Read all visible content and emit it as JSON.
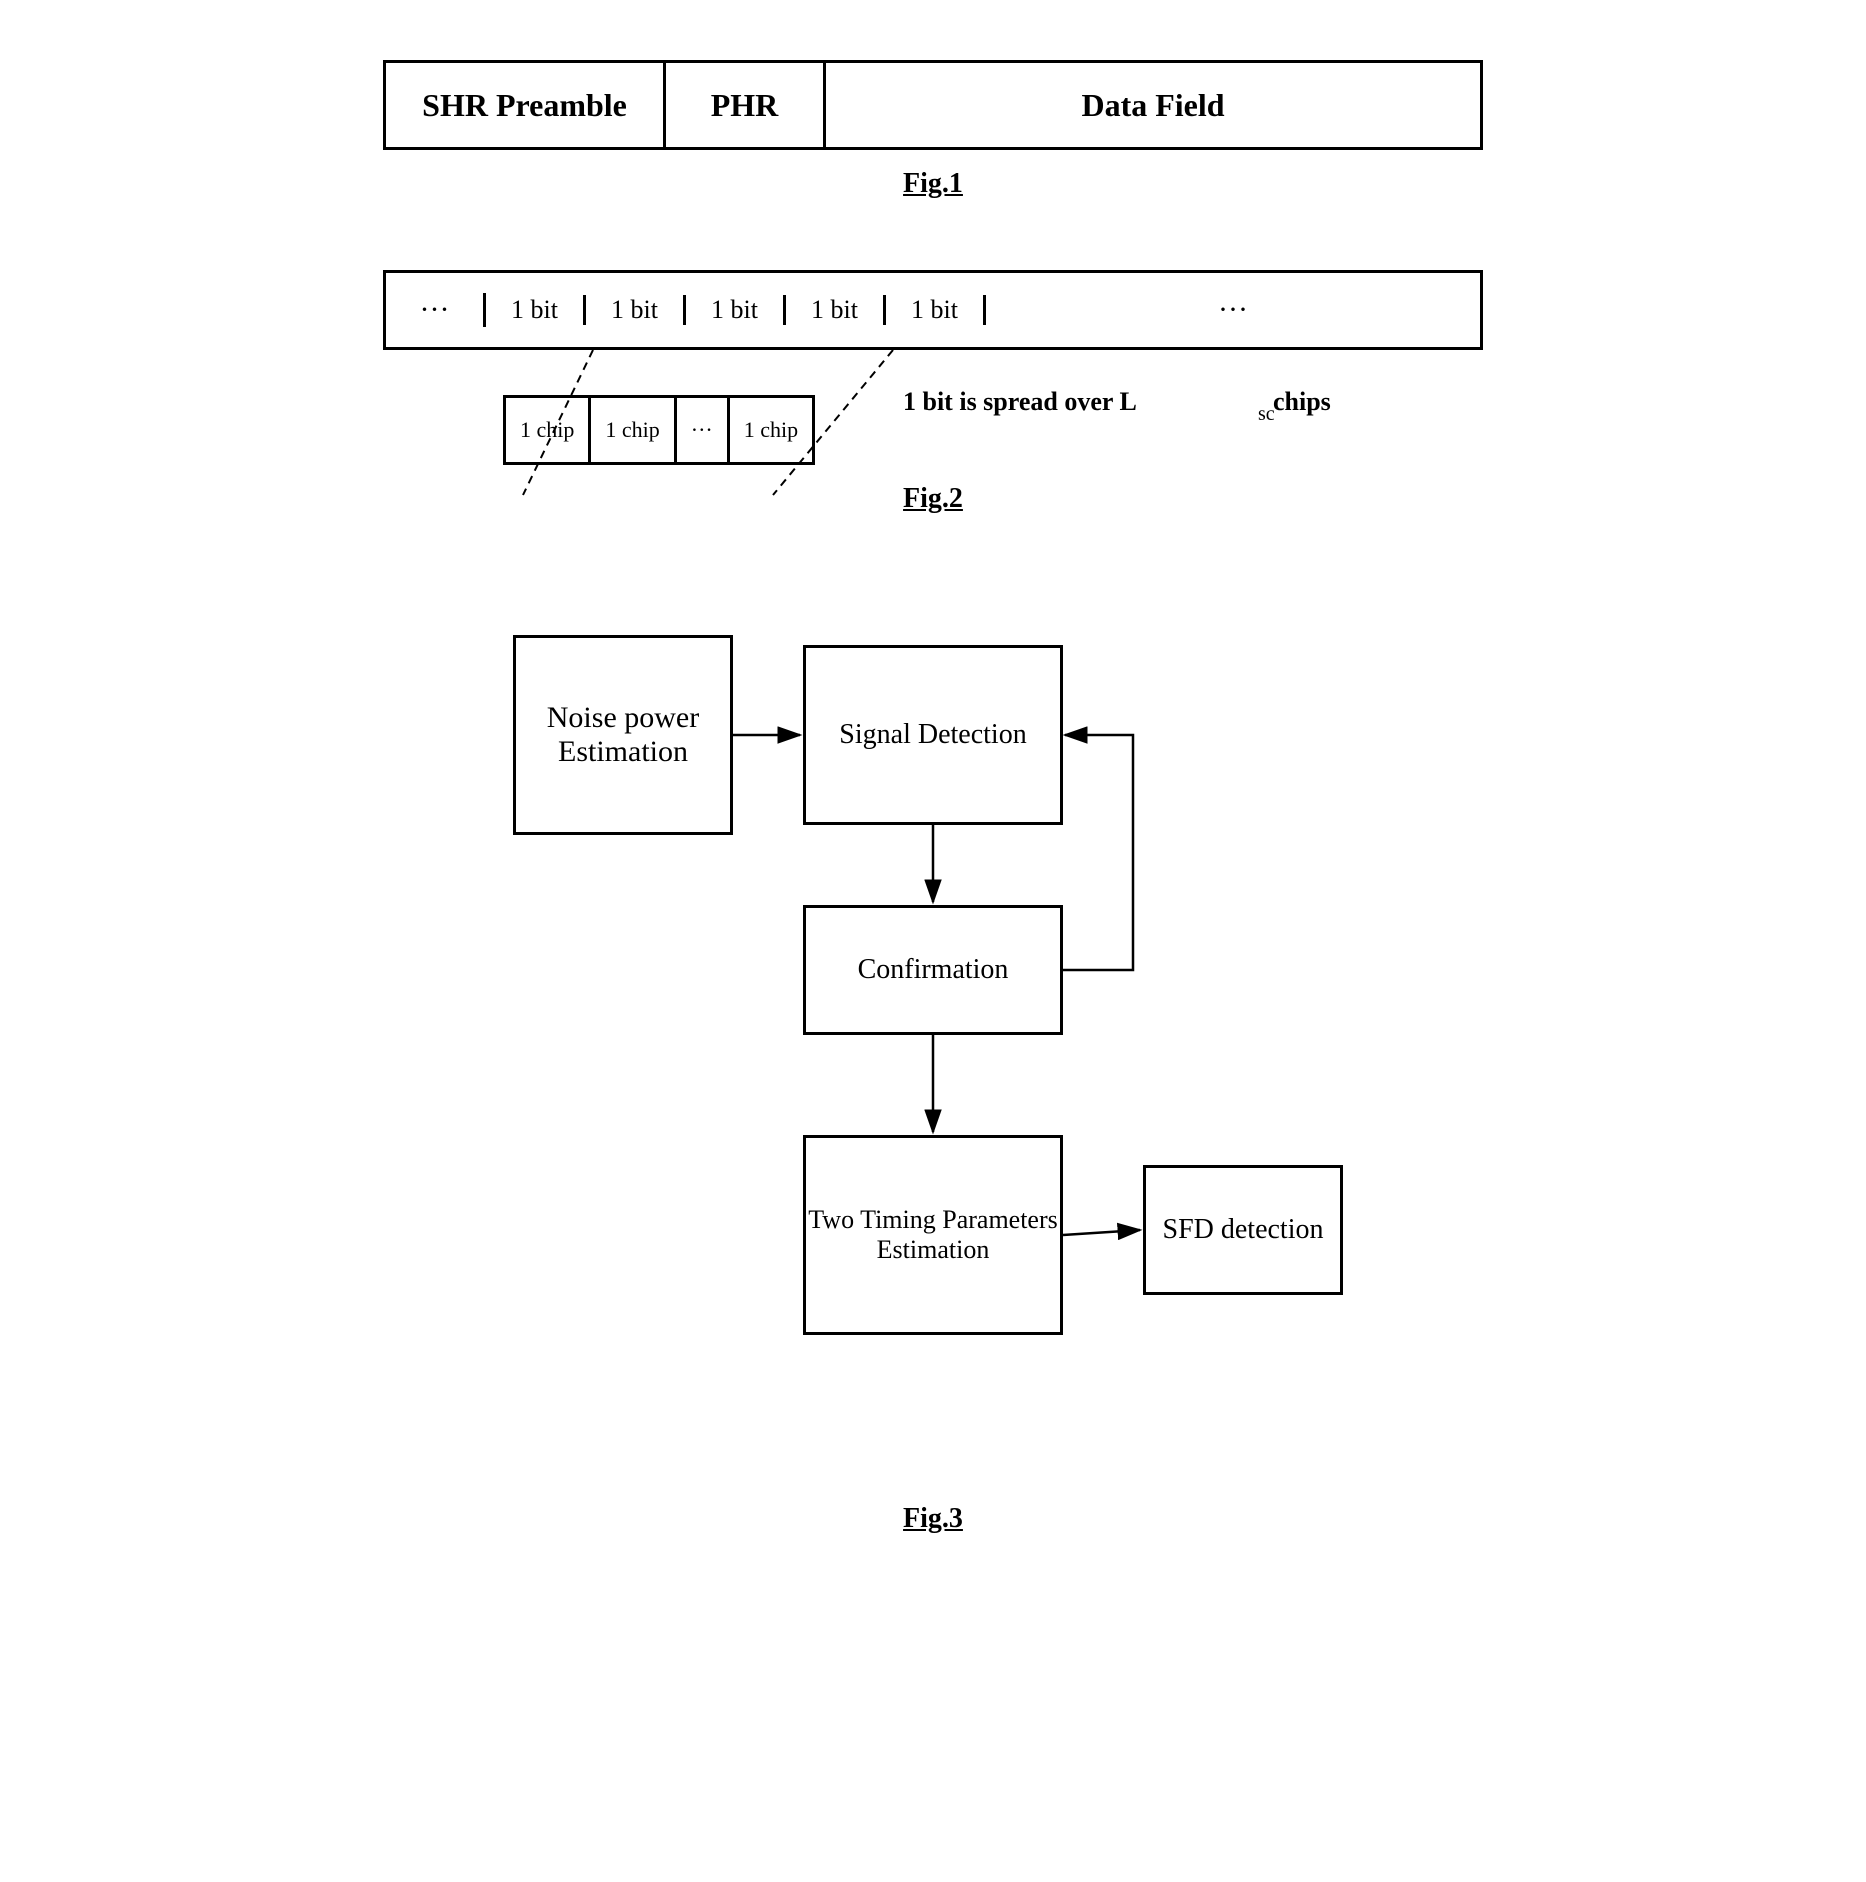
{
  "fig1": {
    "caption": "Fig.1",
    "cells": [
      {
        "label": "SHR Preamble"
      },
      {
        "label": "PHR"
      },
      {
        "label": "Data Field"
      }
    ]
  },
  "fig2": {
    "caption": "Fig.2",
    "top_row": [
      {
        "label": "···",
        "type": "dots-left"
      },
      {
        "label": "1 bit",
        "type": "bit"
      },
      {
        "label": "1 bit",
        "type": "bit"
      },
      {
        "label": "1 bit",
        "type": "bit"
      },
      {
        "label": "1 bit",
        "type": "bit"
      },
      {
        "label": "1 bit",
        "type": "bit"
      },
      {
        "label": "···",
        "type": "dots-right"
      }
    ],
    "spread_label": "1 bit is spread over L",
    "spread_subscript": "sc",
    "spread_suffix": " chips",
    "chips": [
      {
        "label": "1 chip"
      },
      {
        "label": "1 chip"
      },
      {
        "label": "···"
      },
      {
        "label": "1 chip"
      }
    ]
  },
  "fig3": {
    "caption": "Fig.3",
    "boxes": {
      "noise": "Noise power Estimation",
      "signal": "Signal Detection",
      "confirmation": "Confirmation",
      "two_timing": "Two Timing Parameters Estimation",
      "sfd": "SFD detection"
    }
  }
}
